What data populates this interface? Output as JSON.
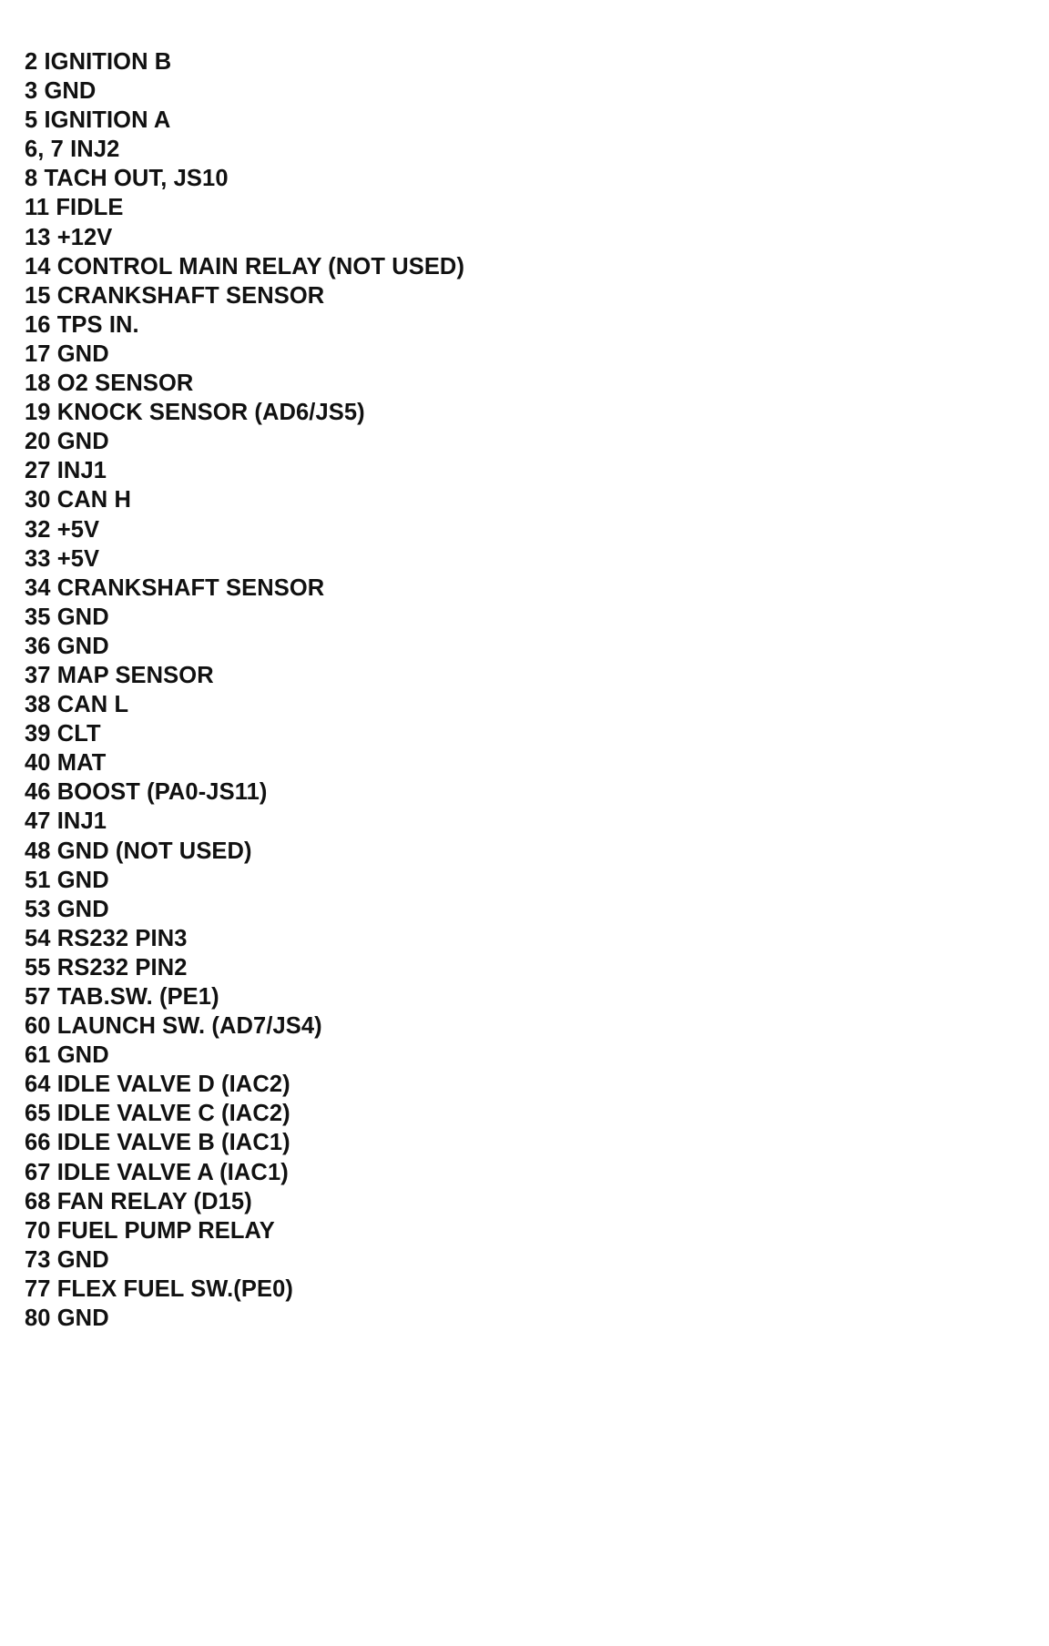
{
  "document": {
    "kind": "ecu-connector-pinout-list",
    "background_color": "#ffffff",
    "text_color": "#111111",
    "lines": [
      {
        "pin": "2",
        "signal": "IGNITION B",
        "text": "2 IGNITION B"
      },
      {
        "pin": "3",
        "signal": "GND",
        "text": "3 GND"
      },
      {
        "pin": "5",
        "signal": "IGNITION A",
        "text": "5 IGNITION A"
      },
      {
        "pin": "6, 7",
        "signal": "INJ2",
        "text": "6, 7 INJ2"
      },
      {
        "pin": "8",
        "signal": "TACH OUT, JS10",
        "text": "8 TACH OUT, JS10"
      },
      {
        "pin": "11",
        "signal": "FIDLE",
        "text": "11 FIDLE"
      },
      {
        "pin": "13",
        "signal": "+12V",
        "text": "13 +12V"
      },
      {
        "pin": "14",
        "signal": "CONTROL MAIN RELAY (NOT USED)",
        "text": "14 CONTROL MAIN RELAY (NOT USED)"
      },
      {
        "pin": "15",
        "signal": "CRANKSHAFT SENSOR",
        "text": "15 CRANKSHAFT SENSOR"
      },
      {
        "pin": "16",
        "signal": "TPS IN.",
        "text": "16 TPS IN."
      },
      {
        "pin": "17",
        "signal": "GND",
        "text": "17 GND"
      },
      {
        "pin": "18",
        "signal": "O2 SENSOR",
        "text": "18 O2 SENSOR"
      },
      {
        "pin": "19",
        "signal": "KNOCK SENSOR (AD6/JS5)",
        "text": "19 KNOCK SENSOR (AD6/JS5)"
      },
      {
        "pin": "20",
        "signal": "GND",
        "text": "20 GND"
      },
      {
        "pin": "27",
        "signal": "INJ1",
        "text": "27 INJ1"
      },
      {
        "pin": "30",
        "signal": "CAN H",
        "text": "30 CAN H"
      },
      {
        "pin": "32",
        "signal": "+5V",
        "text": "32 +5V"
      },
      {
        "pin": "33",
        "signal": "+5V",
        "text": "33 +5V"
      },
      {
        "pin": "34",
        "signal": "CRANKSHAFT SENSOR",
        "text": "34 CRANKSHAFT SENSOR"
      },
      {
        "pin": "35",
        "signal": "GND",
        "text": "35 GND"
      },
      {
        "pin": "36",
        "signal": "GND",
        "text": "36 GND"
      },
      {
        "pin": "37",
        "signal": "MAP SENSOR",
        "text": "37 MAP SENSOR"
      },
      {
        "pin": "38",
        "signal": "CAN L",
        "text": "38 CAN L"
      },
      {
        "pin": "39",
        "signal": "CLT",
        "text": "39 CLT"
      },
      {
        "pin": "40",
        "signal": "MAT",
        "text": "40 MAT"
      },
      {
        "pin": "46",
        "signal": "BOOST (PA0-JS11)",
        "text": "46 BOOST (PA0-JS11)"
      },
      {
        "pin": "47",
        "signal": "INJ1",
        "text": "47 INJ1"
      },
      {
        "pin": "48",
        "signal": "GND (NOT USED)",
        "text": "48 GND (NOT USED)"
      },
      {
        "pin": "51",
        "signal": "GND",
        "text": "51 GND"
      },
      {
        "pin": "53",
        "signal": "GND",
        "text": "53 GND"
      },
      {
        "pin": "54",
        "signal": "RS232 PIN3",
        "text": "54 RS232 PIN3"
      },
      {
        "pin": "55",
        "signal": "RS232 PIN2",
        "text": "55 RS232 PIN2"
      },
      {
        "pin": "57",
        "signal": "TAB.SW. (PE1)",
        "text": "57 TAB.SW. (PE1)"
      },
      {
        "pin": "60",
        "signal": "LAUNCH SW. (AD7/JS4)",
        "text": "60 LAUNCH SW. (AD7/JS4)"
      },
      {
        "pin": "61",
        "signal": "GND",
        "text": "61 GND"
      },
      {
        "pin": "64",
        "signal": "IDLE VALVE D (IAC2)",
        "text": "64 IDLE VALVE D (IAC2)"
      },
      {
        "pin": "65",
        "signal": "IDLE VALVE C (IAC2)",
        "text": "65 IDLE VALVE C (IAC2)"
      },
      {
        "pin": "66",
        "signal": "IDLE VALVE B (IAC1)",
        "text": "66 IDLE VALVE B (IAC1)"
      },
      {
        "pin": "67",
        "signal": "IDLE VALVE A (IAC1)",
        "text": "67 IDLE VALVE A (IAC1)"
      },
      {
        "pin": "68",
        "signal": "FAN RELAY (D15)",
        "text": "68 FAN RELAY (D15)"
      },
      {
        "pin": "70",
        "signal": "FUEL PUMP RELAY",
        "text": "70 FUEL PUMP RELAY"
      },
      {
        "pin": "73",
        "signal": "GND",
        "text": "73 GND"
      },
      {
        "pin": "77",
        "signal": "FLEX FUEL SW.(PE0)",
        "text": "77 FLEX FUEL SW.(PE0)"
      },
      {
        "pin": "80",
        "signal": "GND",
        "text": "80 GND"
      }
    ]
  }
}
